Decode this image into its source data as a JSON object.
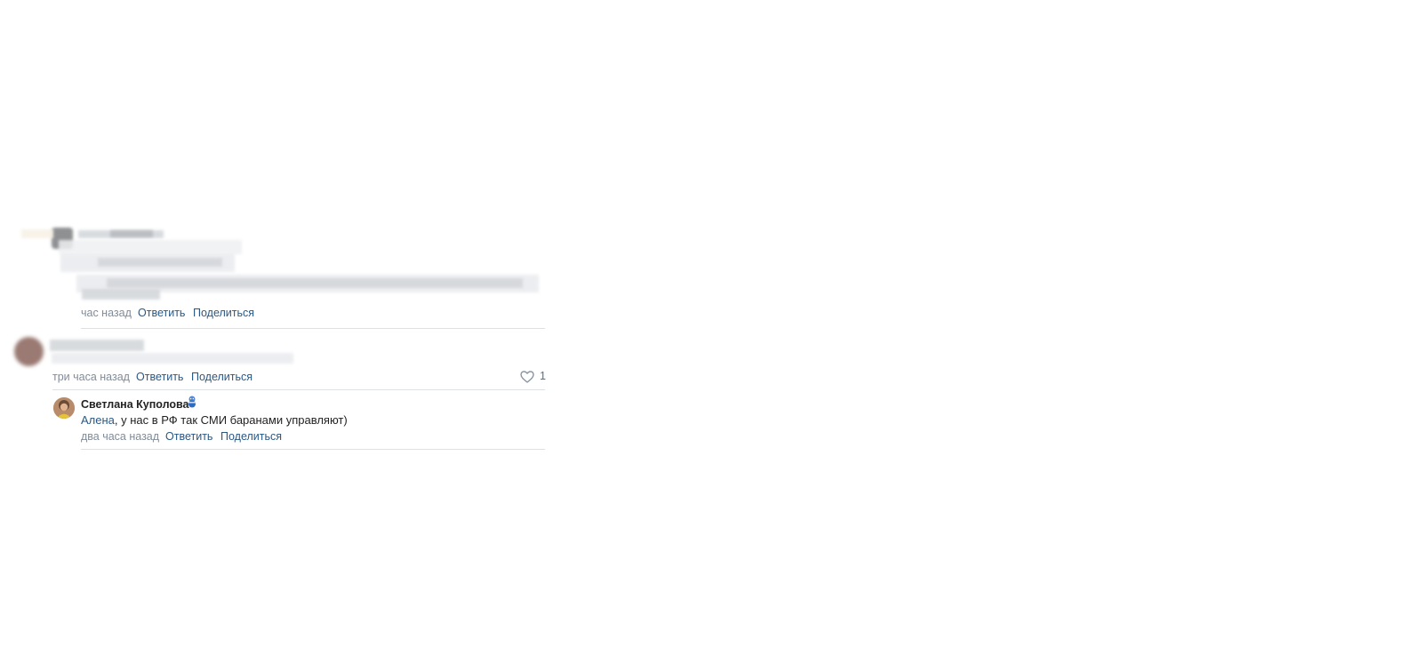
{
  "comments": [
    {
      "time": "час назад",
      "reply_label": "Ответить",
      "share_label": "Поделиться"
    },
    {
      "time": "три часа назад",
      "reply_label": "Ответить",
      "share_label": "Поделиться",
      "likes": "1"
    }
  ],
  "reply": {
    "author": "Светлана Куполова",
    "mention": "Алена",
    "text": ", у нас в РФ так СМИ баранами управляют)",
    "time": "два часа назад",
    "reply_label": "Ответить",
    "share_label": "Поделиться"
  },
  "icons": {
    "like": "heart-outline-icon",
    "badge": "snowman-emoji-icon"
  },
  "colors": {
    "link": "#2a5885",
    "meta": "#818c99",
    "divider": "#dce1e6",
    "text": "#222222"
  }
}
